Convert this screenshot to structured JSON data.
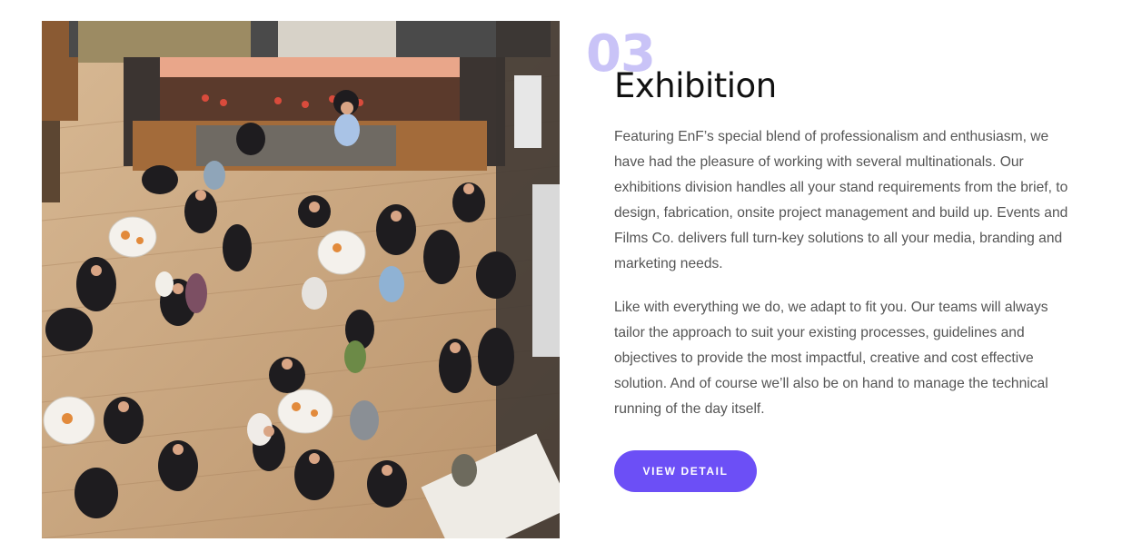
{
  "section": {
    "number": "03",
    "title": "Exhibition",
    "paragraphs": [
      "Featuring EnF’s special blend of professionalism and enthusiasm, we have had the pleasure of working with several multinationals. Our exhibitions division handles all your stand requirements from the brief, to design, fabrication, onsite project management and build up. Events and Films Co. delivers full turn-key solutions to all your media, branding and marketing needs.",
      "Like with everything we do, we adapt to fit you. Our teams will always tailor the approach to suit your existing processes, guidelines and objectives to provide the most impactful, creative and cost effective solution. And of course we’ll also be on hand to manage the technical running of the day itself."
    ],
    "button_label": "VIEW DETAIL"
  },
  "photo": {
    "alt": "Overhead view of a crowded exhibition networking event"
  },
  "colors": {
    "accent": "#6c4ff6",
    "number": "#c9c3f7",
    "title": "#111111",
    "body_text": "#555555"
  }
}
